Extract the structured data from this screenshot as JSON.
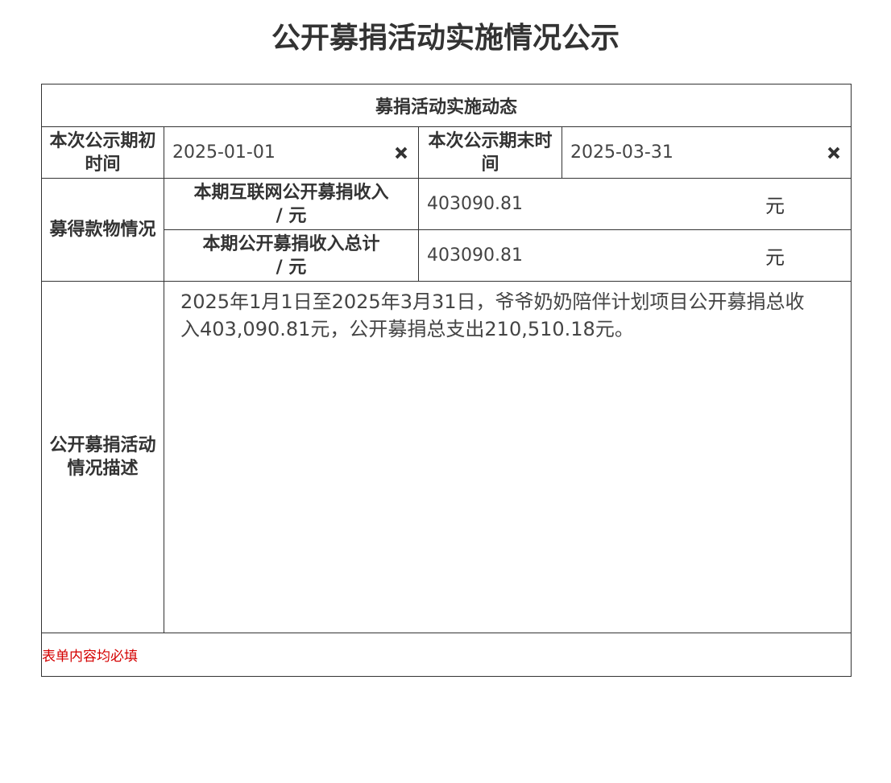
{
  "page": {
    "title": "公开募捐活动实施情况公示"
  },
  "section": {
    "header": "募捐活动实施动态"
  },
  "period": {
    "start_label": "本次公示期初时间",
    "start_value": "2025-01-01",
    "end_label": "本次公示期末时间",
    "end_value": "2025-03-31",
    "clear_icon": "close-x-icon"
  },
  "donations": {
    "group_label": "募得款物情况",
    "internet_label": "本期互联网公开募捐收入 / 元",
    "internet_value": "403090.81",
    "internet_unit": "元",
    "total_label": "本期公开募捐收入总计 / 元",
    "total_value": "403090.81",
    "total_unit": "元"
  },
  "description": {
    "label": "公开募捐活动情况描述",
    "text": "2025年1月1日至2025年3月31日，爷爷奶奶陪伴计划项目公开募捐总收入403,090.81元，公开募捐总支出210,510.18元。"
  },
  "footer": {
    "note": "表单内容均必填"
  },
  "colors": {
    "border": "#333333",
    "text": "#333333",
    "note": "#d40000"
  }
}
